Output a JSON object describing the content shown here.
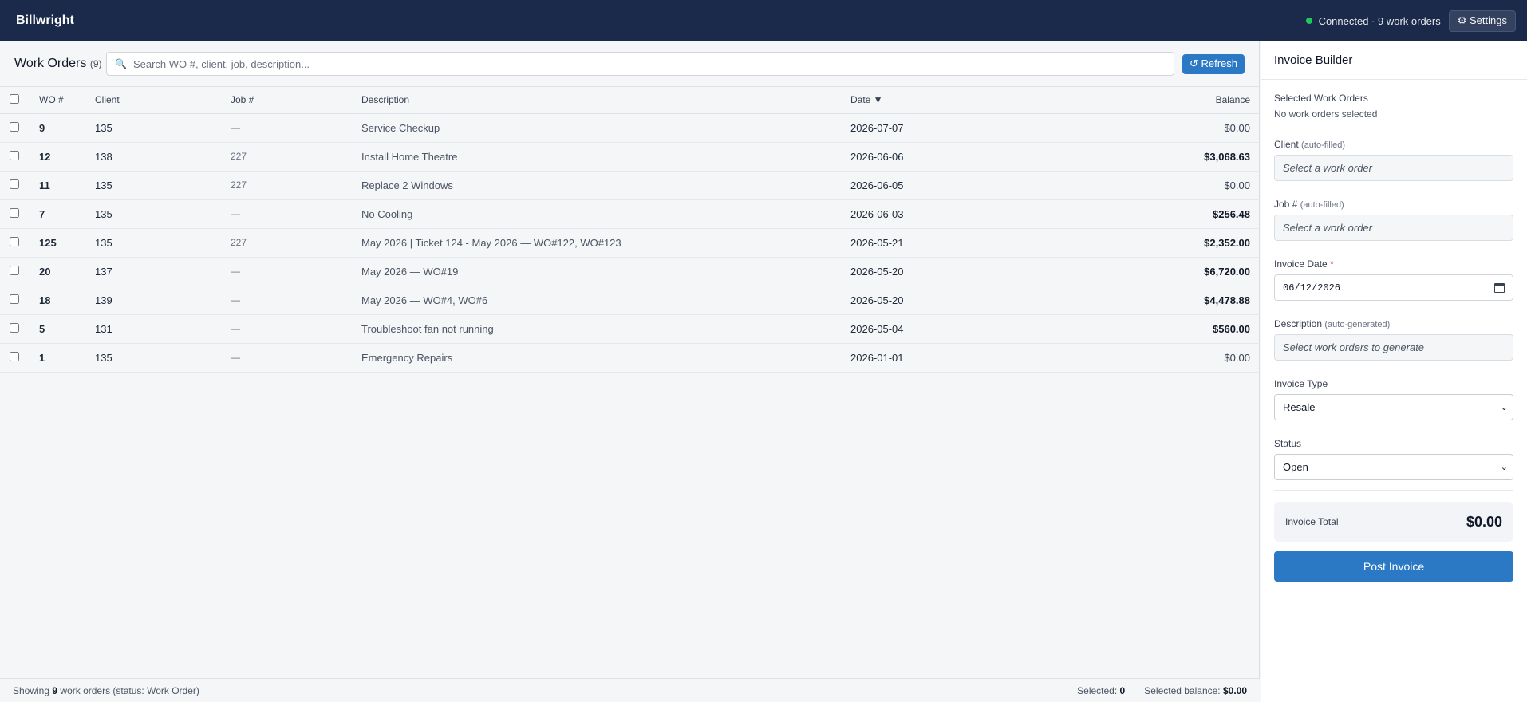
{
  "app": {
    "brand": "Billwright",
    "status_text": "Connected · 9 work orders",
    "settings_label": "⚙ Settings"
  },
  "main": {
    "title": "Work Orders",
    "count": "(9)",
    "search_placeholder": "Search WO #, client, job, description...",
    "refresh_label": "↺ Refresh",
    "columns": {
      "wo": "WO #",
      "client": "Client",
      "job": "Job #",
      "description": "Description",
      "date": "Date ▼",
      "balance": "Balance"
    },
    "rows": [
      {
        "wo": "9",
        "client": "135",
        "job": "—",
        "description": "Service Checkup",
        "date": "2026-07-07",
        "balance": "$0.00"
      },
      {
        "wo": "12",
        "client": "138",
        "job": "227",
        "description": "Install Home Theatre",
        "date": "2026-06-06",
        "balance": "$3,068.63"
      },
      {
        "wo": "11",
        "client": "135",
        "job": "227",
        "description": "Replace 2 Windows",
        "date": "2026-06-05",
        "balance": "$0.00"
      },
      {
        "wo": "7",
        "client": "135",
        "job": "—",
        "description": "No Cooling",
        "date": "2026-06-03",
        "balance": "$256.48"
      },
      {
        "wo": "125",
        "client": "135",
        "job": "227",
        "description": "May 2026 | Ticket 124 - May 2026 — WO#122, WO#123",
        "date": "2026-05-21",
        "balance": "$2,352.00"
      },
      {
        "wo": "20",
        "client": "137",
        "job": "—",
        "description": "May 2026 — WO#19",
        "date": "2026-05-20",
        "balance": "$6,720.00"
      },
      {
        "wo": "18",
        "client": "139",
        "job": "—",
        "description": "May 2026 — WO#4, WO#6",
        "date": "2026-05-20",
        "balance": "$4,478.88"
      },
      {
        "wo": "5",
        "client": "131",
        "job": "—",
        "description": "Troubleshoot fan not running",
        "date": "2026-05-04",
        "balance": "$560.00"
      },
      {
        "wo": "1",
        "client": "135",
        "job": "—",
        "description": "Emergency Repairs",
        "date": "2026-01-01",
        "balance": "$0.00"
      }
    ],
    "footer": {
      "showing_prefix": "Showing",
      "showing_count": "9",
      "showing_suffix": "work orders (status: Work Order)",
      "selected_label": "Selected:",
      "selected_value": "0",
      "selected_balance_label": "Selected balance:",
      "selected_balance_value": "$0.00"
    }
  },
  "panel": {
    "title": "Invoice Builder",
    "selected_label": "Selected Work Orders",
    "selected_empty": "No work orders selected",
    "client_label": "Client",
    "client_hint": "(auto-filled)",
    "client_value": "Select a work order",
    "job_label": "Job #",
    "job_hint": "(auto-filled)",
    "job_value": "Select a work order",
    "date_label": "Invoice Date",
    "date_required": "*",
    "date_value": "06/12/2026",
    "desc_label": "Description",
    "desc_hint": "(auto-generated)",
    "desc_value": "Select work orders to generate",
    "type_label": "Invoice Type",
    "type_value": "Resale",
    "status_label": "Status",
    "status_value": "Open",
    "total_label": "Invoice Total",
    "total_value": "$0.00",
    "post_label": "Post Invoice"
  },
  "colors": {
    "topbar": "#1b2a4a",
    "accent": "#2b78c5",
    "connected": "#22c55e"
  }
}
